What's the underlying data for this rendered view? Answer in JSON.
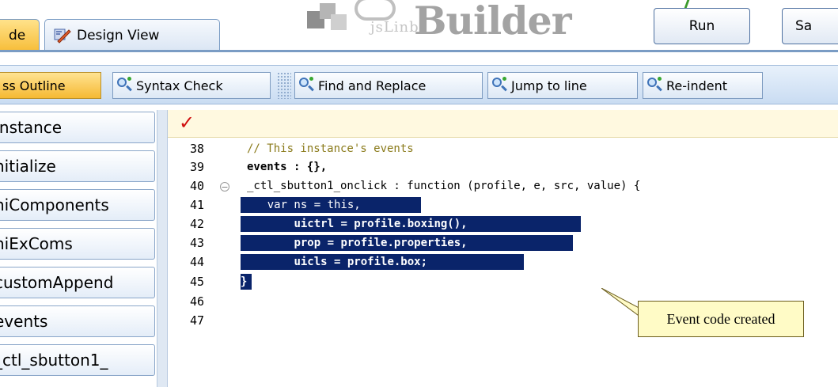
{
  "tabs": {
    "active_label": "de",
    "design_label": "Design View"
  },
  "logo": {
    "small_text": "jsLinb",
    "big_text": "Builder"
  },
  "actions": {
    "run_label": "Run",
    "save_label": "Sa"
  },
  "toolbar": {
    "outline_label": "ss Outline",
    "syntax_label": "Syntax Check",
    "find_label": "Find and Replace",
    "jump_label": "Jump to line",
    "reindent_label": "Re-indent"
  },
  "outline": {
    "items": [
      "Instance",
      "nitialize",
      "niComponents",
      "niExComs",
      "customAppend",
      "events",
      "_ctl_sbutton1_"
    ]
  },
  "editor": {
    "status_icon": "checkmark-icon",
    "lines": [
      {
        "n": "38",
        "text": "// This instance's events"
      },
      {
        "n": "39",
        "text": "events : {},"
      },
      {
        "n": "40",
        "text": "_ctl_sbutton1_onclick : function (profile, e, src, value) {"
      },
      {
        "n": "41",
        "text": "var ns = this,"
      },
      {
        "n": "42",
        "text": "uictrl = profile.boxing(),"
      },
      {
        "n": "43",
        "text": "prop = profile.properties,"
      },
      {
        "n": "44",
        "text": "uicls = profile.box;"
      },
      {
        "n": "45",
        "text": "}"
      },
      {
        "n": "46",
        "text": ""
      },
      {
        "n": "47",
        "text": ""
      }
    ],
    "selection_color": "#0a246a"
  },
  "callout": {
    "text": "Event code created"
  }
}
